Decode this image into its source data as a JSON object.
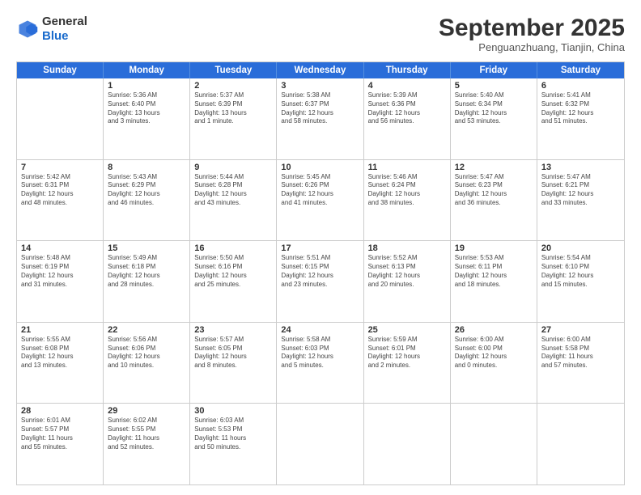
{
  "header": {
    "logo_general": "General",
    "logo_blue": "Blue",
    "month_title": "September 2025",
    "location": "Penguanzhuang, Tianjin, China"
  },
  "days_of_week": [
    "Sunday",
    "Monday",
    "Tuesday",
    "Wednesday",
    "Thursday",
    "Friday",
    "Saturday"
  ],
  "weeks": [
    [
      {
        "day": "",
        "info": ""
      },
      {
        "day": "1",
        "info": "Sunrise: 5:36 AM\nSunset: 6:40 PM\nDaylight: 13 hours\nand 3 minutes."
      },
      {
        "day": "2",
        "info": "Sunrise: 5:37 AM\nSunset: 6:39 PM\nDaylight: 13 hours\nand 1 minute."
      },
      {
        "day": "3",
        "info": "Sunrise: 5:38 AM\nSunset: 6:37 PM\nDaylight: 12 hours\nand 58 minutes."
      },
      {
        "day": "4",
        "info": "Sunrise: 5:39 AM\nSunset: 6:36 PM\nDaylight: 12 hours\nand 56 minutes."
      },
      {
        "day": "5",
        "info": "Sunrise: 5:40 AM\nSunset: 6:34 PM\nDaylight: 12 hours\nand 53 minutes."
      },
      {
        "day": "6",
        "info": "Sunrise: 5:41 AM\nSunset: 6:32 PM\nDaylight: 12 hours\nand 51 minutes."
      }
    ],
    [
      {
        "day": "7",
        "info": "Sunrise: 5:42 AM\nSunset: 6:31 PM\nDaylight: 12 hours\nand 48 minutes."
      },
      {
        "day": "8",
        "info": "Sunrise: 5:43 AM\nSunset: 6:29 PM\nDaylight: 12 hours\nand 46 minutes."
      },
      {
        "day": "9",
        "info": "Sunrise: 5:44 AM\nSunset: 6:28 PM\nDaylight: 12 hours\nand 43 minutes."
      },
      {
        "day": "10",
        "info": "Sunrise: 5:45 AM\nSunset: 6:26 PM\nDaylight: 12 hours\nand 41 minutes."
      },
      {
        "day": "11",
        "info": "Sunrise: 5:46 AM\nSunset: 6:24 PM\nDaylight: 12 hours\nand 38 minutes."
      },
      {
        "day": "12",
        "info": "Sunrise: 5:47 AM\nSunset: 6:23 PM\nDaylight: 12 hours\nand 36 minutes."
      },
      {
        "day": "13",
        "info": "Sunrise: 5:47 AM\nSunset: 6:21 PM\nDaylight: 12 hours\nand 33 minutes."
      }
    ],
    [
      {
        "day": "14",
        "info": "Sunrise: 5:48 AM\nSunset: 6:19 PM\nDaylight: 12 hours\nand 31 minutes."
      },
      {
        "day": "15",
        "info": "Sunrise: 5:49 AM\nSunset: 6:18 PM\nDaylight: 12 hours\nand 28 minutes."
      },
      {
        "day": "16",
        "info": "Sunrise: 5:50 AM\nSunset: 6:16 PM\nDaylight: 12 hours\nand 25 minutes."
      },
      {
        "day": "17",
        "info": "Sunrise: 5:51 AM\nSunset: 6:15 PM\nDaylight: 12 hours\nand 23 minutes."
      },
      {
        "day": "18",
        "info": "Sunrise: 5:52 AM\nSunset: 6:13 PM\nDaylight: 12 hours\nand 20 minutes."
      },
      {
        "day": "19",
        "info": "Sunrise: 5:53 AM\nSunset: 6:11 PM\nDaylight: 12 hours\nand 18 minutes."
      },
      {
        "day": "20",
        "info": "Sunrise: 5:54 AM\nSunset: 6:10 PM\nDaylight: 12 hours\nand 15 minutes."
      }
    ],
    [
      {
        "day": "21",
        "info": "Sunrise: 5:55 AM\nSunset: 6:08 PM\nDaylight: 12 hours\nand 13 minutes."
      },
      {
        "day": "22",
        "info": "Sunrise: 5:56 AM\nSunset: 6:06 PM\nDaylight: 12 hours\nand 10 minutes."
      },
      {
        "day": "23",
        "info": "Sunrise: 5:57 AM\nSunset: 6:05 PM\nDaylight: 12 hours\nand 8 minutes."
      },
      {
        "day": "24",
        "info": "Sunrise: 5:58 AM\nSunset: 6:03 PM\nDaylight: 12 hours\nand 5 minutes."
      },
      {
        "day": "25",
        "info": "Sunrise: 5:59 AM\nSunset: 6:01 PM\nDaylight: 12 hours\nand 2 minutes."
      },
      {
        "day": "26",
        "info": "Sunrise: 6:00 AM\nSunset: 6:00 PM\nDaylight: 12 hours\nand 0 minutes."
      },
      {
        "day": "27",
        "info": "Sunrise: 6:00 AM\nSunset: 5:58 PM\nDaylight: 11 hours\nand 57 minutes."
      }
    ],
    [
      {
        "day": "28",
        "info": "Sunrise: 6:01 AM\nSunset: 5:57 PM\nDaylight: 11 hours\nand 55 minutes."
      },
      {
        "day": "29",
        "info": "Sunrise: 6:02 AM\nSunset: 5:55 PM\nDaylight: 11 hours\nand 52 minutes."
      },
      {
        "day": "30",
        "info": "Sunrise: 6:03 AM\nSunset: 5:53 PM\nDaylight: 11 hours\nand 50 minutes."
      },
      {
        "day": "",
        "info": ""
      },
      {
        "day": "",
        "info": ""
      },
      {
        "day": "",
        "info": ""
      },
      {
        "day": "",
        "info": ""
      }
    ]
  ]
}
